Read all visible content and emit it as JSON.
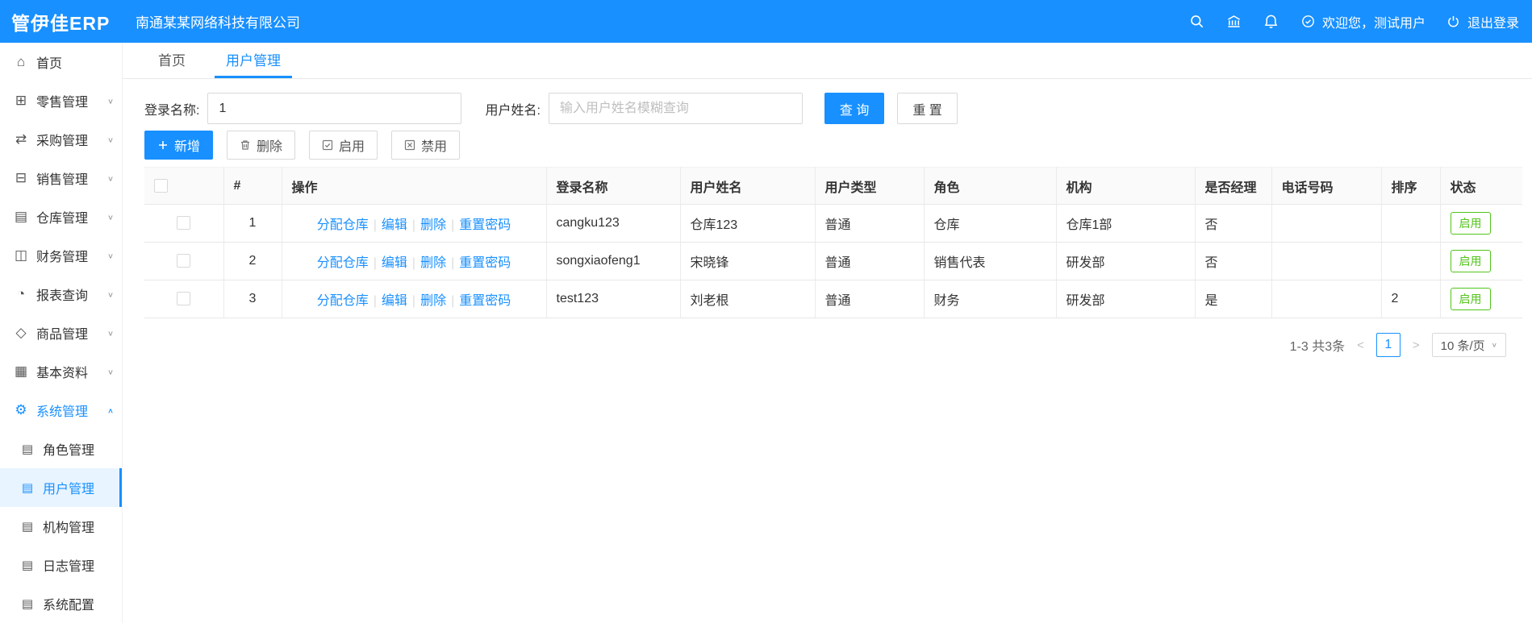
{
  "header": {
    "logo": "管伊佳ERP",
    "company": "南通某某网络科技有限公司",
    "welcome": "欢迎您，测试用户",
    "logout": "退出登录"
  },
  "sidebar": {
    "items": [
      {
        "label": "首页",
        "icon": "⌂"
      },
      {
        "label": "零售管理",
        "icon": "⊞"
      },
      {
        "label": "采购管理",
        "icon": "⇄"
      },
      {
        "label": "销售管理",
        "icon": "⊟"
      },
      {
        "label": "仓库管理",
        "icon": "▤"
      },
      {
        "label": "财务管理",
        "icon": "◫"
      },
      {
        "label": "报表查询",
        "icon": "◔"
      },
      {
        "label": "商品管理",
        "icon": "◇"
      },
      {
        "label": "基本资料",
        "icon": "▦"
      },
      {
        "label": "系统管理",
        "icon": "⚙"
      }
    ],
    "subitems": [
      {
        "label": "角色管理",
        "icon": "▤"
      },
      {
        "label": "用户管理",
        "icon": "▤"
      },
      {
        "label": "机构管理",
        "icon": "▤"
      },
      {
        "label": "日志管理",
        "icon": "▤"
      },
      {
        "label": "系统配置",
        "icon": "▤"
      }
    ]
  },
  "tabs": {
    "home": "首页",
    "current": "用户管理"
  },
  "filters": {
    "login_name_label": "登录名称:",
    "login_name_value": "1",
    "user_name_label": "用户姓名:",
    "user_name_placeholder": "输入用户姓名模糊查询",
    "search_button": "查 询",
    "reset_button": "重 置"
  },
  "toolbar": {
    "add": "新增",
    "delete": "删除",
    "enable": "启用",
    "disable": "禁用"
  },
  "table": {
    "headers": [
      "#",
      "操作",
      "登录名称",
      "用户姓名",
      "用户类型",
      "角色",
      "机构",
      "是否经理",
      "电话号码",
      "排序",
      "状态"
    ],
    "actions": [
      "分配仓库",
      "编辑",
      "删除",
      "重置密码"
    ],
    "action_separator": "|",
    "rows": [
      {
        "index": "1",
        "login": "cangku123",
        "name": "仓库123",
        "type": "普通",
        "role": "仓库",
        "org": "仓库1部",
        "manager": "否",
        "phone": "",
        "sort": "",
        "status": "启用"
      },
      {
        "index": "2",
        "login": "songxiaofeng1",
        "name": "宋晓锋",
        "type": "普通",
        "role": "销售代表",
        "org": "研发部",
        "manager": "否",
        "phone": "",
        "sort": "",
        "status": "启用"
      },
      {
        "index": "3",
        "login": "test123",
        "name": "刘老根",
        "type": "普通",
        "role": "财务",
        "org": "研发部",
        "manager": "是",
        "phone": "",
        "sort": "2",
        "status": "启用"
      }
    ]
  },
  "pagination": {
    "total": "1-3 共3条",
    "prev": "<",
    "page": "1",
    "next": ">",
    "page_size": "10 条/页"
  },
  "icons": {
    "chevron_down": "∨",
    "chevron_up": "∧",
    "select_caret": "∨"
  }
}
